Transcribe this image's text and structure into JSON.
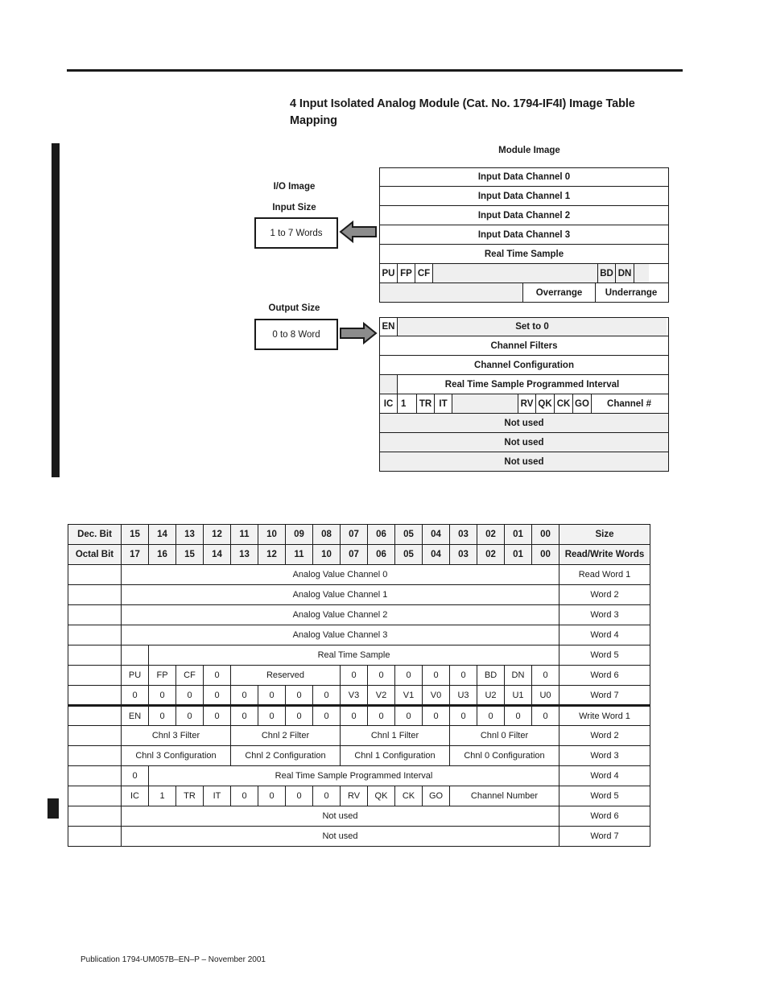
{
  "title": "4 Input Isolated Analog Module (Cat. No. 1794-IF4I) Image Table Mapping",
  "footer": "Publication 1794-UM057B–EN–P – November 2001",
  "diagram": {
    "module_image_label": "Module Image",
    "io_image_label": "I/O Image",
    "input_size_label": "Input Size",
    "input_size_value": "1 to 7 Words",
    "output_size_label": "Output Size",
    "output_size_value": "0 to 8 Word",
    "input_rows": [
      "Input Data Channel 0",
      "Input Data Channel 1",
      "Input Data Channel 2",
      "Input Data Channel 3",
      "Real Time Sample"
    ],
    "status_row": {
      "pu": "PU",
      "fp": "FP",
      "cf": "CF",
      "bd": "BD",
      "dn": "DN"
    },
    "range_row": {
      "overrange": "Overrange",
      "underrange": "Underrange"
    },
    "output_rows": {
      "en": "EN",
      "set_to_0": "Set to 0",
      "channel_filters": "Channel Filters",
      "channel_configuration": "Channel Configuration",
      "rts_interval": "Real Time Sample Programmed Interval",
      "control": {
        "ic": "IC",
        "one": "1",
        "tr": "TR",
        "it": "IT",
        "rv": "RV",
        "qk": "QK",
        "ck": "CK",
        "go": "GO",
        "channel": "Channel #"
      },
      "not_used": [
        "Not used",
        "Not used",
        "Not used"
      ]
    }
  },
  "table": {
    "header_dec_label": "Dec. Bit",
    "header_octal_label": "Octal Bit",
    "header_size_label": "Size",
    "header_rw_label": "Read/Write Words",
    "dec_bits": [
      "15",
      "14",
      "13",
      "12",
      "11",
      "10",
      "09",
      "08",
      "07",
      "06",
      "05",
      "04",
      "03",
      "02",
      "01",
      "00"
    ],
    "octal_bits": [
      "17",
      "16",
      "15",
      "14",
      "13",
      "12",
      "11",
      "10",
      "07",
      "06",
      "05",
      "04",
      "03",
      "02",
      "01",
      "00"
    ],
    "rows": [
      {
        "cells": [
          {
            "t": "Analog Value Channel 0",
            "s": 16
          }
        ],
        "size": "Read Word 1"
      },
      {
        "cells": [
          {
            "t": "Analog Value Channel 1",
            "s": 16
          }
        ],
        "size": "Word 2"
      },
      {
        "cells": [
          {
            "t": "Analog Value Channel 2",
            "s": 16
          }
        ],
        "size": "Word 3"
      },
      {
        "cells": [
          {
            "t": "Analog Value Channel 3",
            "s": 16
          }
        ],
        "size": "Word 4"
      },
      {
        "cells": [
          {
            "t": "",
            "s": 1
          },
          {
            "t": "Real Time Sample",
            "s": 15
          }
        ],
        "size": "Word 5"
      },
      {
        "cells": [
          {
            "t": "PU",
            "s": 1
          },
          {
            "t": "FP",
            "s": 1
          },
          {
            "t": "CF",
            "s": 1
          },
          {
            "t": "0",
            "s": 1
          },
          {
            "t": "Reserved",
            "s": 4
          },
          {
            "t": "0",
            "s": 1
          },
          {
            "t": "0",
            "s": 1
          },
          {
            "t": "0",
            "s": 1
          },
          {
            "t": "0",
            "s": 1
          },
          {
            "t": "0",
            "s": 1
          },
          {
            "t": "BD",
            "s": 1
          },
          {
            "t": "DN",
            "s": 1
          },
          {
            "t": "0",
            "s": 1
          }
        ],
        "size": "Word 6"
      },
      {
        "cells": [
          {
            "t": "0",
            "s": 1
          },
          {
            "t": "0",
            "s": 1
          },
          {
            "t": "0",
            "s": 1
          },
          {
            "t": "0",
            "s": 1
          },
          {
            "t": "0",
            "s": 1
          },
          {
            "t": "0",
            "s": 1
          },
          {
            "t": "0",
            "s": 1
          },
          {
            "t": "0",
            "s": 1
          },
          {
            "t": "V3",
            "s": 1
          },
          {
            "t": "V2",
            "s": 1
          },
          {
            "t": "V1",
            "s": 1
          },
          {
            "t": "V0",
            "s": 1
          },
          {
            "t": "U3",
            "s": 1
          },
          {
            "t": "U2",
            "s": 1
          },
          {
            "t": "U1",
            "s": 1
          },
          {
            "t": "U0",
            "s": 1
          }
        ],
        "size": "Word 7",
        "thick_bottom": true
      },
      {
        "cells": [
          {
            "t": "EN",
            "s": 1
          },
          {
            "t": "0",
            "s": 1
          },
          {
            "t": "0",
            "s": 1
          },
          {
            "t": "0",
            "s": 1
          },
          {
            "t": "0",
            "s": 1
          },
          {
            "t": "0",
            "s": 1
          },
          {
            "t": "0",
            "s": 1
          },
          {
            "t": "0",
            "s": 1
          },
          {
            "t": "0",
            "s": 1
          },
          {
            "t": "0",
            "s": 1
          },
          {
            "t": "0",
            "s": 1
          },
          {
            "t": "0",
            "s": 1
          },
          {
            "t": "0",
            "s": 1
          },
          {
            "t": "0",
            "s": 1
          },
          {
            "t": "0",
            "s": 1
          },
          {
            "t": "0",
            "s": 1
          }
        ],
        "size": "Write Word 1",
        "thick_top": true
      },
      {
        "cells": [
          {
            "t": "Chnl 3 Filter",
            "s": 4
          },
          {
            "t": "Chnl 2 Filter",
            "s": 4
          },
          {
            "t": "Chnl 1 Filter",
            "s": 4
          },
          {
            "t": "Chnl 0 Filter",
            "s": 4
          }
        ],
        "size": "Word 2"
      },
      {
        "cells": [
          {
            "t": "Chnl 3 Configuration",
            "s": 4
          },
          {
            "t": "Chnl 2 Configuration",
            "s": 4
          },
          {
            "t": "Chnl 1 Configuration",
            "s": 4
          },
          {
            "t": "Chnl 0 Configuration",
            "s": 4
          }
        ],
        "size": "Word 3"
      },
      {
        "cells": [
          {
            "t": "0",
            "s": 1
          },
          {
            "t": "Real Time Sample Programmed Interval",
            "s": 15
          }
        ],
        "size": "Word 4"
      },
      {
        "cells": [
          {
            "t": "IC",
            "s": 1
          },
          {
            "t": "1",
            "s": 1
          },
          {
            "t": "TR",
            "s": 1
          },
          {
            "t": "IT",
            "s": 1
          },
          {
            "t": "0",
            "s": 1
          },
          {
            "t": "0",
            "s": 1
          },
          {
            "t": "0",
            "s": 1
          },
          {
            "t": "0",
            "s": 1
          },
          {
            "t": "RV",
            "s": 1
          },
          {
            "t": "QK",
            "s": 1
          },
          {
            "t": "CK",
            "s": 1
          },
          {
            "t": "GO",
            "s": 1
          },
          {
            "t": "Channel Number",
            "s": 4
          }
        ],
        "size": "Word 5"
      },
      {
        "cells": [
          {
            "t": "Not used",
            "s": 16
          }
        ],
        "size": "Word 6"
      },
      {
        "cells": [
          {
            "t": "Not used",
            "s": 16
          }
        ],
        "size": "Word 7"
      }
    ]
  }
}
